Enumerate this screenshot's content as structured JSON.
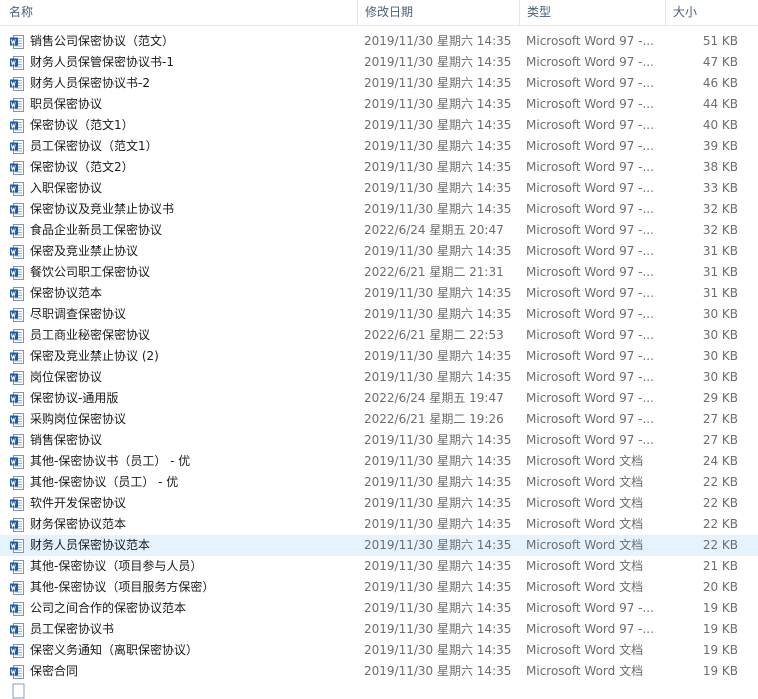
{
  "header": {
    "name": "名称",
    "date": "修改日期",
    "type": "类型",
    "size": "大小"
  },
  "icon": "word-document-icon",
  "accent": "#1e5aa8",
  "selected_bg": "#e5f3ff",
  "files": [
    {
      "name": "销售公司保密协议（范文）",
      "date": "2019/11/30 星期六 14:35",
      "type": "Microsoft Word 97 -...",
      "size": "51 KB"
    },
    {
      "name": "财务人员保管保密协议书-1",
      "date": "2019/11/30 星期六 14:35",
      "type": "Microsoft Word 97 -...",
      "size": "47 KB"
    },
    {
      "name": "财务人员保密协议书-2",
      "date": "2019/11/30 星期六 14:35",
      "type": "Microsoft Word 97 -...",
      "size": "46 KB"
    },
    {
      "name": "职员保密协议",
      "date": "2019/11/30 星期六 14:35",
      "type": "Microsoft Word 97 -...",
      "size": "44 KB"
    },
    {
      "name": "保密协议（范文1）",
      "date": "2019/11/30 星期六 14:35",
      "type": "Microsoft Word 97 -...",
      "size": "40 KB"
    },
    {
      "name": "员工保密协议（范文1）",
      "date": "2019/11/30 星期六 14:35",
      "type": "Microsoft Word 97 -...",
      "size": "39 KB"
    },
    {
      "name": "保密协议（范文2）",
      "date": "2019/11/30 星期六 14:35",
      "type": "Microsoft Word 97 -...",
      "size": "38 KB"
    },
    {
      "name": "入职保密协议",
      "date": "2019/11/30 星期六 14:35",
      "type": "Microsoft Word 97 -...",
      "size": "33 KB"
    },
    {
      "name": "保密协议及竞业禁止协议书",
      "date": "2019/11/30 星期六 14:35",
      "type": "Microsoft Word 97 -...",
      "size": "32 KB"
    },
    {
      "name": "食品企业新员工保密协议",
      "date": "2022/6/24 星期五 20:47",
      "type": "Microsoft Word 97 -...",
      "size": "32 KB"
    },
    {
      "name": "保密及竞业禁止协议",
      "date": "2019/11/30 星期六 14:35",
      "type": "Microsoft Word 97 -...",
      "size": "31 KB"
    },
    {
      "name": "餐饮公司职工保密协议",
      "date": "2022/6/21 星期二 21:31",
      "type": "Microsoft Word 97 -...",
      "size": "31 KB"
    },
    {
      "name": "保密协议范本",
      "date": "2019/11/30 星期六 14:35",
      "type": "Microsoft Word 97 -...",
      "size": "31 KB"
    },
    {
      "name": "尽职调查保密协议",
      "date": "2019/11/30 星期六 14:35",
      "type": "Microsoft Word 97 -...",
      "size": "30 KB"
    },
    {
      "name": "员工商业秘密保密协议",
      "date": "2022/6/21 星期二 22:53",
      "type": "Microsoft Word 97 -...",
      "size": "30 KB"
    },
    {
      "name": "保密及竞业禁止协议 (2)",
      "date": "2019/11/30 星期六 14:35",
      "type": "Microsoft Word 97 -...",
      "size": "30 KB"
    },
    {
      "name": "岗位保密协议",
      "date": "2019/11/30 星期六 14:35",
      "type": "Microsoft Word 97 -...",
      "size": "30 KB"
    },
    {
      "name": "保密协议-通用版",
      "date": "2022/6/24 星期五 19:47",
      "type": "Microsoft Word 97 -...",
      "size": "29 KB"
    },
    {
      "name": "采购岗位保密协议",
      "date": "2022/6/21 星期二 19:26",
      "type": "Microsoft Word 97 -...",
      "size": "27 KB"
    },
    {
      "name": "销售保密协议",
      "date": "2019/11/30 星期六 14:35",
      "type": "Microsoft Word 97 -...",
      "size": "27 KB"
    },
    {
      "name": "其他-保密协议书（员工） - 优",
      "date": "2019/11/30 星期六 14:35",
      "type": "Microsoft Word 文档",
      "size": "24 KB"
    },
    {
      "name": "其他-保密协议（员工） - 优",
      "date": "2019/11/30 星期六 14:35",
      "type": "Microsoft Word 文档",
      "size": "22 KB"
    },
    {
      "name": "软件开发保密协议",
      "date": "2019/11/30 星期六 14:35",
      "type": "Microsoft Word 文档",
      "size": "22 KB"
    },
    {
      "name": "财务保密协议范本",
      "date": "2019/11/30 星期六 14:35",
      "type": "Microsoft Word 文档",
      "size": "22 KB"
    },
    {
      "name": "财务人员保密协议范本",
      "date": "2019/11/30 星期六 14:35",
      "type": "Microsoft Word 文档",
      "size": "22 KB",
      "selected": true
    },
    {
      "name": "其他-保密协议（项目参与人员）",
      "date": "2019/11/30 星期六 14:35",
      "type": "Microsoft Word 文档",
      "size": "21 KB"
    },
    {
      "name": "其他-保密协议（项目服务方保密）",
      "date": "2019/11/30 星期六 14:35",
      "type": "Microsoft Word 文档",
      "size": "20 KB"
    },
    {
      "name": "公司之间合作的保密协议范本",
      "date": "2019/11/30 星期六 14:35",
      "type": "Microsoft Word 97 -...",
      "size": "19 KB"
    },
    {
      "name": "员工保密协议书",
      "date": "2019/11/30 星期六 14:35",
      "type": "Microsoft Word 97 -...",
      "size": "19 KB"
    },
    {
      "name": "保密义务通知（离职保密协议）",
      "date": "2019/11/30 星期六 14:35",
      "type": "Microsoft Word 文档",
      "size": "19 KB"
    },
    {
      "name": "保密合同",
      "date": "2019/11/30 星期六 14:35",
      "type": "Microsoft Word 文档",
      "size": "19 KB"
    }
  ]
}
